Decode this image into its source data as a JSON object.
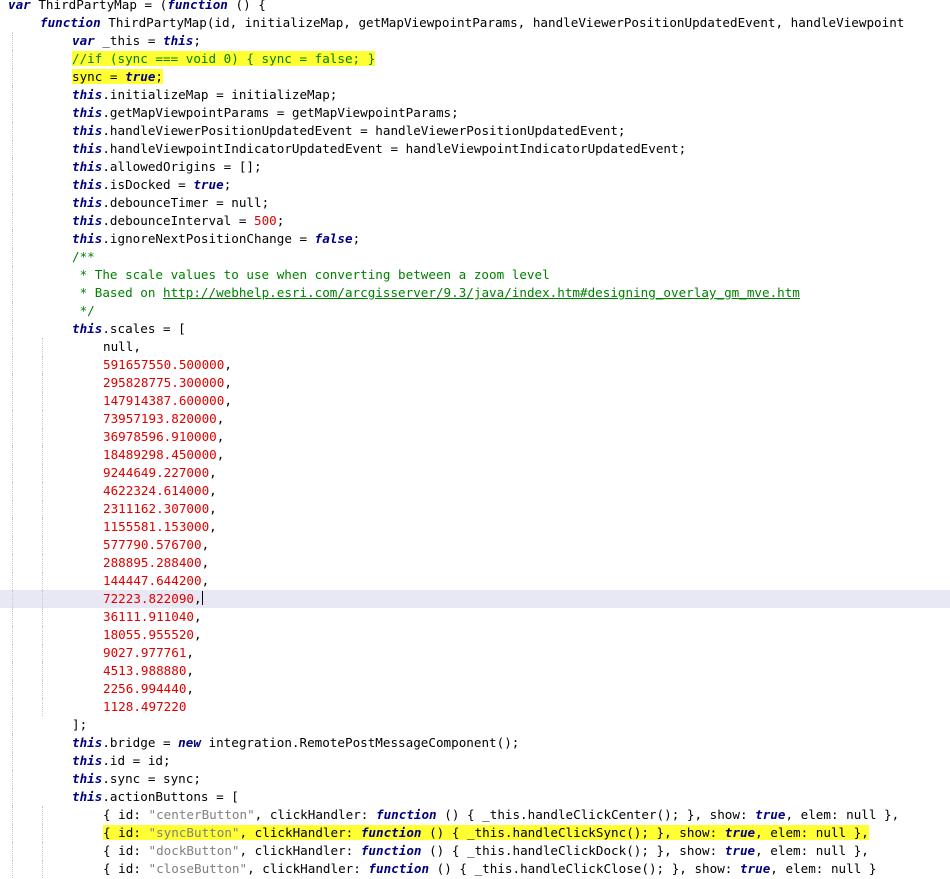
{
  "editor": {
    "name": "source-editor",
    "current_line_index": 33,
    "highlight_color": "#ffff33",
    "lines": [
      {
        "indent": 0,
        "tokens": [
          [
            "kw",
            "var"
          ],
          [
            "p",
            " ThirdPartyMap = ("
          ],
          [
            "kw",
            "function"
          ],
          [
            "p",
            " () {"
          ]
        ]
      },
      {
        "indent": 1,
        "tokens": [
          [
            "kw",
            "function"
          ],
          [
            "p",
            " ThirdPartyMap(id, initializeMap, getMapViewpointParams, handleViewerPositionUpdatedEvent, handleViewpoint"
          ]
        ]
      },
      {
        "indent": 2,
        "tokens": [
          [
            "kw",
            "var"
          ],
          [
            "p",
            " _this = "
          ],
          [
            "kw",
            "this"
          ],
          [
            "p",
            ";"
          ]
        ]
      },
      {
        "indent": 2,
        "highlight": true,
        "tokens": [
          [
            "cm",
            "//if (sync === void 0) { sync = false; }"
          ]
        ]
      },
      {
        "indent": 2,
        "highlight": true,
        "tokens": [
          [
            "p",
            "sync = "
          ],
          [
            "kw",
            "true"
          ],
          [
            "p",
            ";"
          ]
        ]
      },
      {
        "indent": 2,
        "tokens": [
          [
            "kw",
            "this"
          ],
          [
            "p",
            ".initializeMap = initializeMap;"
          ]
        ]
      },
      {
        "indent": 2,
        "tokens": [
          [
            "kw",
            "this"
          ],
          [
            "p",
            ".getMapViewpointParams = getMapViewpointParams;"
          ]
        ]
      },
      {
        "indent": 2,
        "tokens": [
          [
            "kw",
            "this"
          ],
          [
            "p",
            ".handleViewerPositionUpdatedEvent = handleViewerPositionUpdatedEvent;"
          ]
        ]
      },
      {
        "indent": 2,
        "tokens": [
          [
            "kw",
            "this"
          ],
          [
            "p",
            ".handleViewpointIndicatorUpdatedEvent = handleViewpointIndicatorUpdatedEvent;"
          ]
        ]
      },
      {
        "indent": 2,
        "tokens": [
          [
            "kw",
            "this"
          ],
          [
            "p",
            ".allowedOrigins = [];"
          ]
        ]
      },
      {
        "indent": 2,
        "tokens": [
          [
            "kw",
            "this"
          ],
          [
            "p",
            ".isDocked = "
          ],
          [
            "kw",
            "true"
          ],
          [
            "p",
            ";"
          ]
        ]
      },
      {
        "indent": 2,
        "tokens": [
          [
            "kw",
            "this"
          ],
          [
            "p",
            ".debounceTimer = null;"
          ]
        ]
      },
      {
        "indent": 2,
        "tokens": [
          [
            "kw",
            "this"
          ],
          [
            "p",
            ".debounceInterval = "
          ],
          [
            "num",
            "500"
          ],
          [
            "p",
            ";"
          ]
        ]
      },
      {
        "indent": 2,
        "tokens": [
          [
            "kw",
            "this"
          ],
          [
            "p",
            ".ignoreNextPositionChange = "
          ],
          [
            "kw",
            "false"
          ],
          [
            "p",
            ";"
          ]
        ]
      },
      {
        "indent": 2,
        "tokens": [
          [
            "cm",
            "/**"
          ]
        ]
      },
      {
        "indent": 2,
        "tokens": [
          [
            "cm",
            " * The scale values to use when converting between a zoom level"
          ]
        ]
      },
      {
        "indent": 2,
        "tokens": [
          [
            "cm",
            " * Based on "
          ],
          [
            "cmlink",
            "http://webhelp.esri.com/arcgisserver/9.3/java/index.htm#designing_overlay_gm_mve.htm"
          ]
        ]
      },
      {
        "indent": 2,
        "tokens": [
          [
            "cm",
            " */"
          ]
        ]
      },
      {
        "indent": 2,
        "tokens": [
          [
            "kw",
            "this"
          ],
          [
            "p",
            ".scales = ["
          ]
        ]
      },
      {
        "indent": 3,
        "tokens": [
          [
            "p",
            "null,"
          ]
        ]
      },
      {
        "indent": 3,
        "tokens": [
          [
            "num",
            "591657550.500000"
          ],
          [
            "p",
            ","
          ]
        ]
      },
      {
        "indent": 3,
        "tokens": [
          [
            "num",
            "295828775.300000"
          ],
          [
            "p",
            ","
          ]
        ]
      },
      {
        "indent": 3,
        "tokens": [
          [
            "num",
            "147914387.600000"
          ],
          [
            "p",
            ","
          ]
        ]
      },
      {
        "indent": 3,
        "tokens": [
          [
            "num",
            "73957193.820000"
          ],
          [
            "p",
            ","
          ]
        ]
      },
      {
        "indent": 3,
        "tokens": [
          [
            "num",
            "36978596.910000"
          ],
          [
            "p",
            ","
          ]
        ]
      },
      {
        "indent": 3,
        "tokens": [
          [
            "num",
            "18489298.450000"
          ],
          [
            "p",
            ","
          ]
        ]
      },
      {
        "indent": 3,
        "tokens": [
          [
            "num",
            "9244649.227000"
          ],
          [
            "p",
            ","
          ]
        ]
      },
      {
        "indent": 3,
        "tokens": [
          [
            "num",
            "4622324.614000"
          ],
          [
            "p",
            ","
          ]
        ]
      },
      {
        "indent": 3,
        "tokens": [
          [
            "num",
            "2311162.307000"
          ],
          [
            "p",
            ","
          ]
        ]
      },
      {
        "indent": 3,
        "tokens": [
          [
            "num",
            "1155581.153000"
          ],
          [
            "p",
            ","
          ]
        ]
      },
      {
        "indent": 3,
        "tokens": [
          [
            "num",
            "577790.576700"
          ],
          [
            "p",
            ","
          ]
        ]
      },
      {
        "indent": 3,
        "tokens": [
          [
            "num",
            "288895.288400"
          ],
          [
            "p",
            ","
          ]
        ]
      },
      {
        "indent": 3,
        "tokens": [
          [
            "num",
            "144447.644200"
          ],
          [
            "p",
            ","
          ]
        ]
      },
      {
        "indent": 3,
        "caret": true,
        "tokens": [
          [
            "num",
            "72223.822090"
          ],
          [
            "p",
            ","
          ]
        ]
      },
      {
        "indent": 3,
        "tokens": [
          [
            "num",
            "36111.911040"
          ],
          [
            "p",
            ","
          ]
        ]
      },
      {
        "indent": 3,
        "tokens": [
          [
            "num",
            "18055.955520"
          ],
          [
            "p",
            ","
          ]
        ]
      },
      {
        "indent": 3,
        "tokens": [
          [
            "num",
            "9027.977761"
          ],
          [
            "p",
            ","
          ]
        ]
      },
      {
        "indent": 3,
        "tokens": [
          [
            "num",
            "4513.988880"
          ],
          [
            "p",
            ","
          ]
        ]
      },
      {
        "indent": 3,
        "tokens": [
          [
            "num",
            "2256.994440"
          ],
          [
            "p",
            ","
          ]
        ]
      },
      {
        "indent": 3,
        "tokens": [
          [
            "num",
            "1128.497220"
          ]
        ]
      },
      {
        "indent": 2,
        "tokens": [
          [
            "p",
            "];"
          ]
        ]
      },
      {
        "indent": 2,
        "tokens": [
          [
            "kw",
            "this"
          ],
          [
            "p",
            ".bridge = "
          ],
          [
            "kw",
            "new"
          ],
          [
            "p",
            " integration.RemotePostMessageComponent();"
          ]
        ]
      },
      {
        "indent": 2,
        "tokens": [
          [
            "kw",
            "this"
          ],
          [
            "p",
            ".id = id;"
          ]
        ]
      },
      {
        "indent": 2,
        "tokens": [
          [
            "kw",
            "this"
          ],
          [
            "p",
            ".sync = sync;"
          ]
        ]
      },
      {
        "indent": 2,
        "tokens": [
          [
            "kw",
            "this"
          ],
          [
            "p",
            ".actionButtons = ["
          ]
        ]
      },
      {
        "indent": 3,
        "tokens": [
          [
            "p",
            "{ id: "
          ],
          [
            "str",
            "\"centerButton\""
          ],
          [
            "p",
            ", clickHandler: "
          ],
          [
            "kw",
            "function"
          ],
          [
            "p",
            " () { _this.handleClickCenter(); }, show: "
          ],
          [
            "kw",
            "true"
          ],
          [
            "p",
            ", elem: null },"
          ]
        ]
      },
      {
        "indent": 3,
        "highlight": true,
        "tokens": [
          [
            "p",
            "{ id: "
          ],
          [
            "str",
            "\"syncButton\""
          ],
          [
            "p",
            ", clickHandler: "
          ],
          [
            "kw",
            "function"
          ],
          [
            "p",
            " () { _this.handleClickSync(); }, show: "
          ],
          [
            "kw",
            "true"
          ],
          [
            "p",
            ", elem: null },"
          ]
        ]
      },
      {
        "indent": 3,
        "tokens": [
          [
            "p",
            "{ id: "
          ],
          [
            "str",
            "\"dockButton\""
          ],
          [
            "p",
            ", clickHandler: "
          ],
          [
            "kw",
            "function"
          ],
          [
            "p",
            " () { _this.handleClickDock(); }, show: "
          ],
          [
            "kw",
            "true"
          ],
          [
            "p",
            ", elem: null },"
          ]
        ]
      },
      {
        "indent": 3,
        "tokens": [
          [
            "p",
            "{ id: "
          ],
          [
            "str",
            "\"closeButton\""
          ],
          [
            "p",
            ", clickHandler: "
          ],
          [
            "kw",
            "function"
          ],
          [
            "p",
            " () { _this.handleClickClose(); }, show: "
          ],
          [
            "kw",
            "true"
          ],
          [
            "p",
            ", elem: null }"
          ]
        ]
      }
    ]
  }
}
